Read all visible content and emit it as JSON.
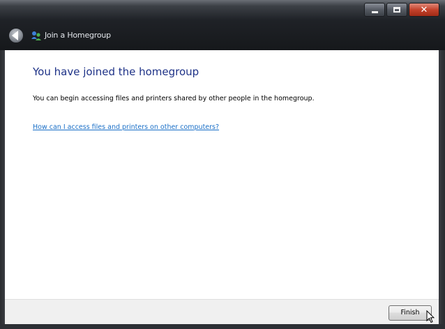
{
  "window": {
    "title": "Join a Homegroup"
  },
  "colors": {
    "heading": "#1e3287",
    "link": "#1a6fc7",
    "chrome_dark": "#16181b",
    "close_button": "#c4422b"
  },
  "icons": {
    "back": "back-arrow-icon",
    "homegroup": "homegroup-icon",
    "minimize": "minimize-icon",
    "maximize": "maximize-icon",
    "close": "close-icon",
    "cursor": "mouse-pointer-icon"
  },
  "main": {
    "heading": "You have joined the homegroup",
    "body": "You can begin accessing files and printers shared by other people in the homegroup.",
    "help_link": "How can I access files and printers on other computers?"
  },
  "footer": {
    "finish_label": "Finish"
  }
}
